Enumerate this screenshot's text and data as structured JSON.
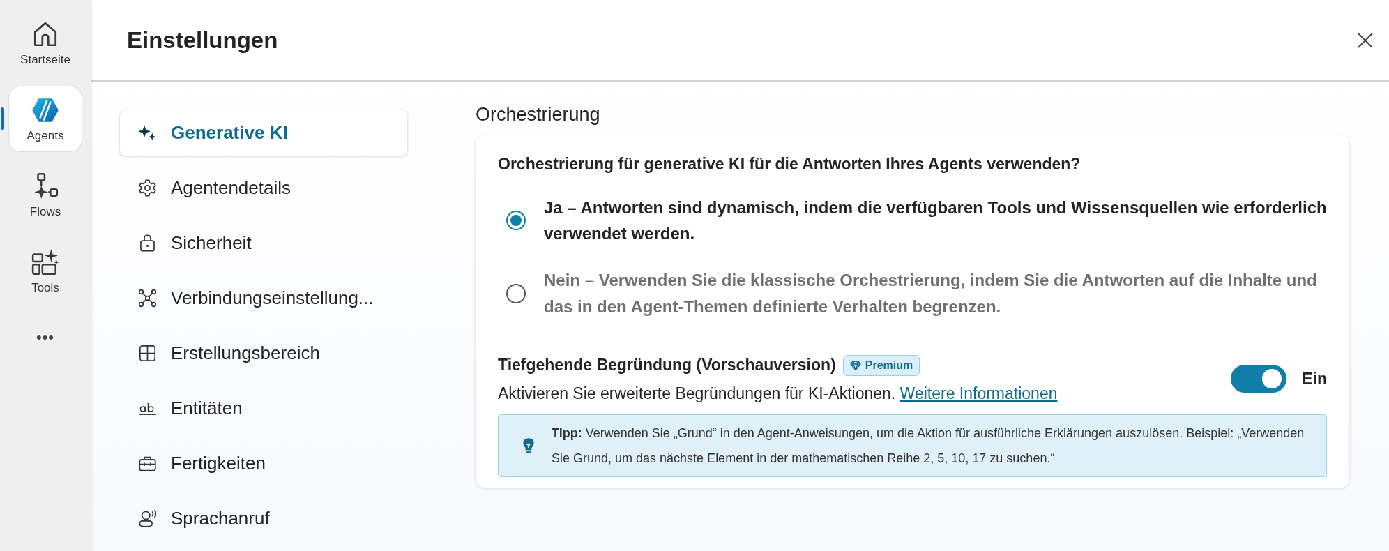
{
  "rail": [
    {
      "label": "Startseite",
      "selected": false
    },
    {
      "label": "Agents",
      "selected": true
    },
    {
      "label": "Flows",
      "selected": false
    },
    {
      "label": "Tools",
      "selected": false
    }
  ],
  "rail_more": "•••",
  "dialog": {
    "title": "Einstellungen"
  },
  "menu": [
    {
      "label": "Generative KI",
      "selected": true
    },
    {
      "label": "Agentendetails",
      "selected": false
    },
    {
      "label": "Sicherheit",
      "selected": false
    },
    {
      "label": "Verbindungseinstellung...",
      "selected": false
    },
    {
      "label": "Erstellungsbereich",
      "selected": false
    },
    {
      "label": "Entitäten",
      "selected": false
    },
    {
      "label": "Fertigkeiten",
      "selected": false
    },
    {
      "label": "Sprachanruf",
      "selected": false
    }
  ],
  "section": {
    "title": "Orchestrierung",
    "question": "Orchestrierung für generative KI für die Antworten Ihres Agents verwenden?",
    "options": [
      {
        "label": "Ja – Antworten sind dynamisch, indem die verfügbaren Tools und Wissensquellen wie erforderlich verwendet werden.",
        "selected": true
      },
      {
        "label": "Nein – Verwenden Sie die klassische Orchestrierung, indem Sie die Antworten auf die Inhalte und das in den Agent-Themen definierte Verhalten begrenzen.",
        "selected": false
      }
    ],
    "deep_reasoning": {
      "title": "Tiefgehende Begründung (Vorschauversion)",
      "badge": "Premium",
      "description": "Aktivieren Sie erweiterte Begründungen für KI-Aktionen.",
      "link": "Weitere Informationen",
      "toggle": {
        "on": true,
        "label": "Ein"
      },
      "tip": "**Tipp:** Verwenden Sie „Grund“ in den Agent-Anweisungen, um die Aktion für ausführliche Erklärungen auszulösen. Beispiel: „Verwenden Sie Grund, um das nächste Element in der mathematischen Reihe 2, 5, 10, 17 zu suchen.“"
    }
  }
}
